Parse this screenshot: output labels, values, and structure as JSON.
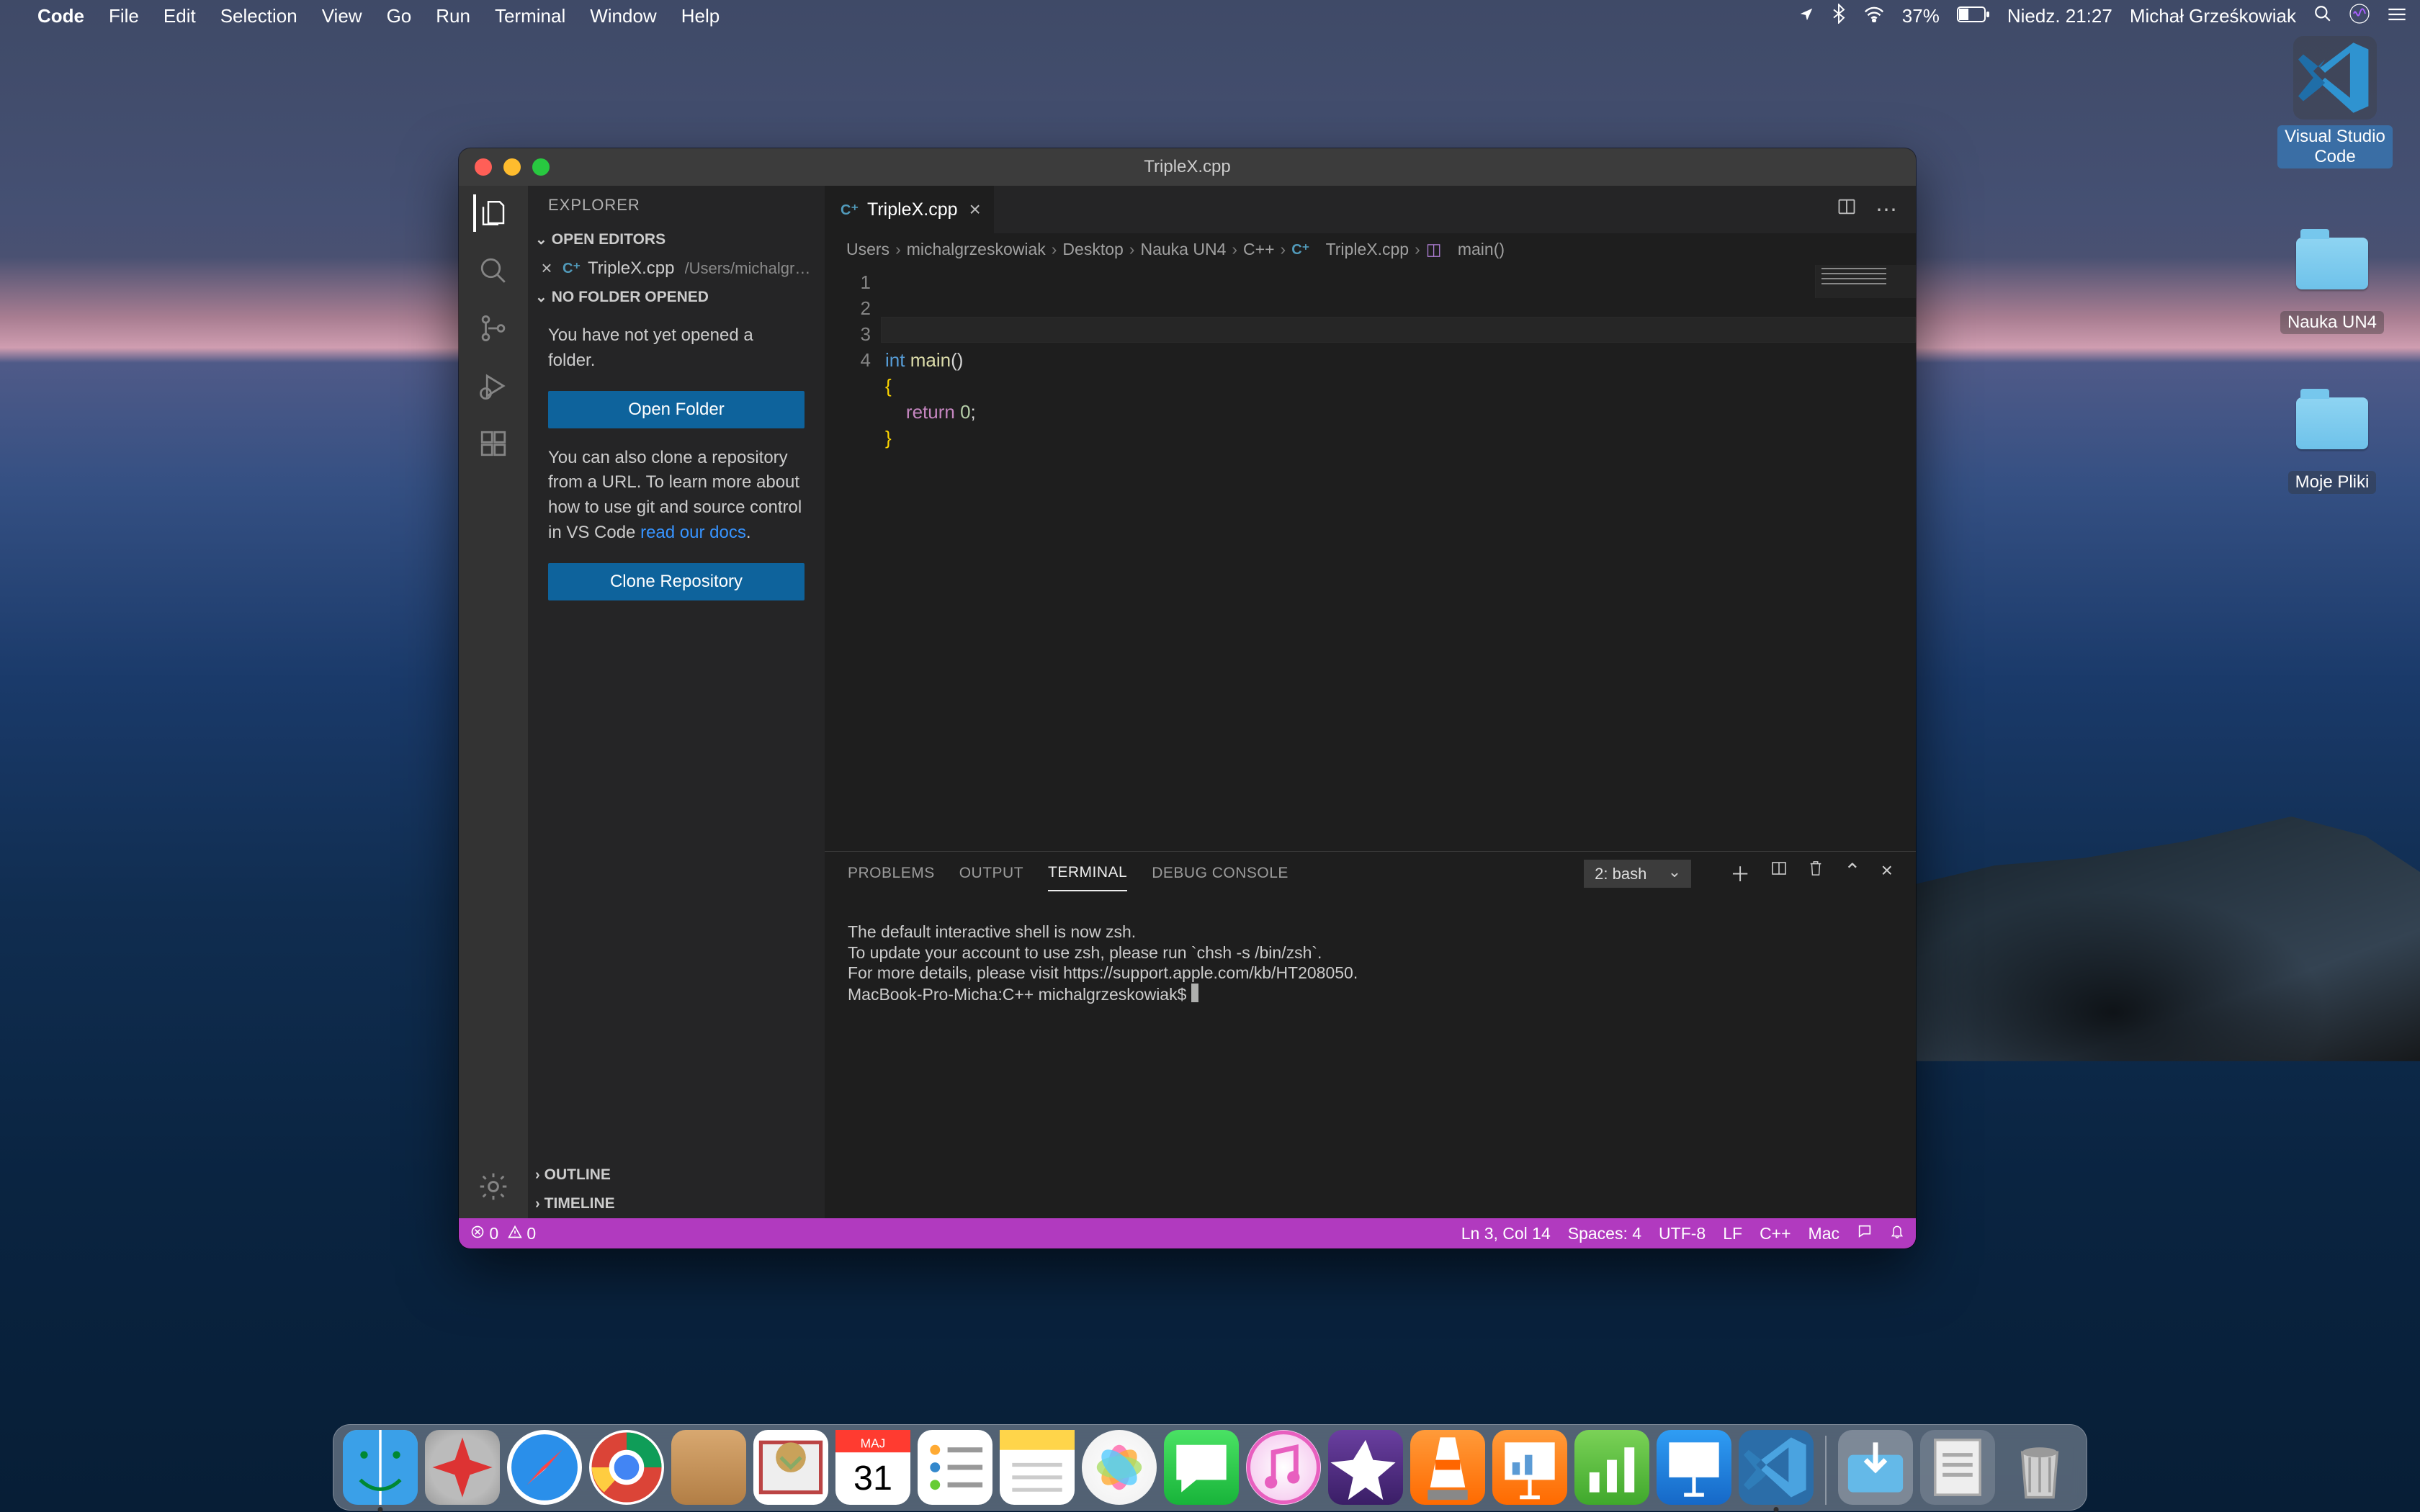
{
  "menubar": {
    "app_name": "Code",
    "items": [
      "File",
      "Edit",
      "Selection",
      "View",
      "Go",
      "Run",
      "Terminal",
      "Window",
      "Help"
    ],
    "battery": "37%",
    "date": "Niedz. 21:27",
    "user": "Michał Grześkowiak"
  },
  "desktop_icons": {
    "vscode": "Visual Studio Code",
    "folder1": "Nauka UN4",
    "folder2": "Moje Pliki"
  },
  "window": {
    "title": "TripleX.cpp",
    "explorer_label": "EXPLORER",
    "open_editors_label": "OPEN EDITORS",
    "open_file": "TripleX.cpp",
    "open_file_path": "/Users/michalgrzesko...",
    "no_folder_label": "NO FOLDER OPENED",
    "no_folder_msg": "You have not yet opened a folder.",
    "open_folder_btn": "Open Folder",
    "clone_msg_1": "You can also clone a repository from a URL. To learn more about how to use git and source control in VS Code ",
    "clone_link": "read our docs",
    "clone_msg_2": ".",
    "clone_btn": "Clone Repository",
    "outline_label": "OUTLINE",
    "timeline_label": "TIMELINE"
  },
  "tab": {
    "name": "TripleX.cpp"
  },
  "breadcrumb": [
    "Users",
    "michalgrzeskowiak",
    "Desktop",
    "Nauka UN4",
    "C++",
    "TripleX.cpp",
    "main()"
  ],
  "code": {
    "lines": [
      {
        "n": "1",
        "tokens": [
          {
            "c": "tok-kw",
            "t": "int"
          },
          {
            "c": "",
            "t": " "
          },
          {
            "c": "tok-fn",
            "t": "main"
          },
          {
            "c": "tok-punct",
            "t": "()"
          }
        ]
      },
      {
        "n": "2",
        "tokens": [
          {
            "c": "tok-brace",
            "t": "{"
          }
        ]
      },
      {
        "n": "3",
        "tokens": [
          {
            "c": "",
            "t": "    "
          },
          {
            "c": "tok-flow",
            "t": "return"
          },
          {
            "c": "",
            "t": " "
          },
          {
            "c": "tok-num",
            "t": "0"
          },
          {
            "c": "tok-punct",
            "t": ";"
          }
        ]
      },
      {
        "n": "4",
        "tokens": [
          {
            "c": "tok-brace",
            "t": "}"
          }
        ]
      }
    ]
  },
  "panel": {
    "tabs": {
      "problems": "PROBLEMS",
      "output": "OUTPUT",
      "terminal": "TERMINAL",
      "debug": "DEBUG CONSOLE"
    },
    "shell_select": "2: bash",
    "lines": [
      "",
      "The default interactive shell is now zsh.",
      "To update your account to use zsh, please run `chsh -s /bin/zsh`.",
      "For more details, please visit https://support.apple.com/kb/HT208050."
    ],
    "prompt": "MacBook-Pro-Micha:C++ michalgrzeskowiak$ "
  },
  "status": {
    "errors": "0",
    "warnings": "0",
    "pos": "Ln 3, Col 14",
    "spaces": "Spaces: 4",
    "enc": "UTF-8",
    "eol": "LF",
    "lang": "C++",
    "os": "Mac"
  }
}
